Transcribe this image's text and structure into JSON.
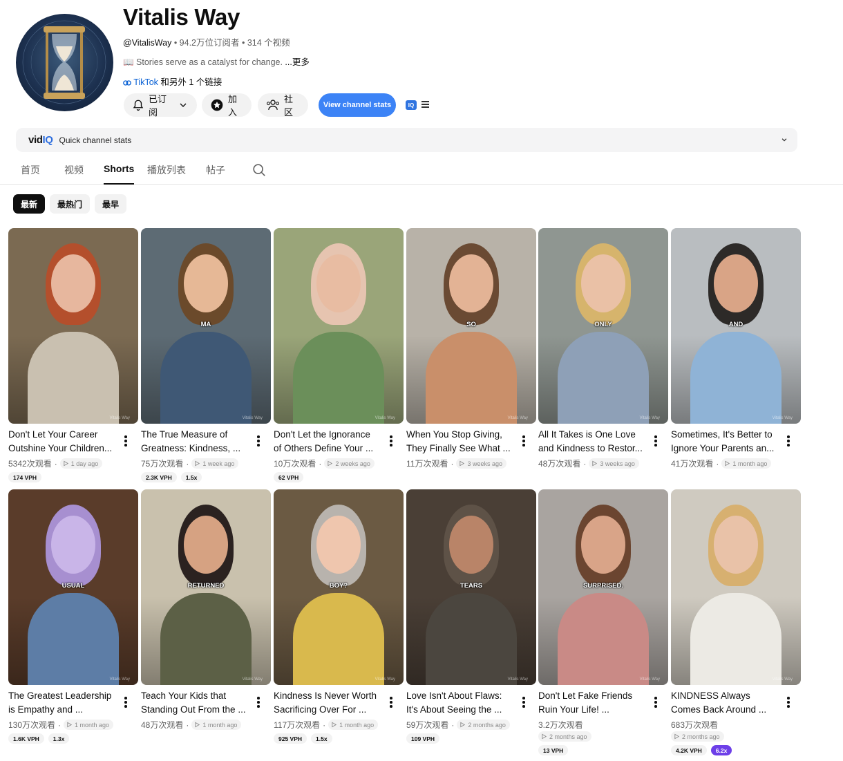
{
  "channel": {
    "name": "Vitalis Way",
    "handle": "@VitalisWay",
    "subs_and_videos": " • 94.2万位订阅者 • 314 个视频",
    "description": "📖 Stories serve as a catalyst for change. ",
    "more": "...更多",
    "link_name": "TikTok",
    "link_rest": " 和另外 1 个链接"
  },
  "buttons": {
    "subscribed": "已订阅",
    "join": "加入",
    "community": "社区",
    "view_stats": "View channel stats",
    "iq": "IQ"
  },
  "vidiq": {
    "logo_a": "vid",
    "logo_b": "IQ",
    "label": "Quick channel stats"
  },
  "tabs": [
    "首页",
    "视频",
    "Shorts",
    "播放列表",
    "帖子"
  ],
  "chips": [
    "最新",
    "最热门",
    "最早"
  ],
  "videos": [
    {
      "title1": "Don't Let Your Career",
      "title2": "Outshine Your Children...",
      "views": "5342次观看",
      "age": "1 day ago",
      "tags": [
        "174 VPH"
      ],
      "word": "",
      "bg": "#7b6a52",
      "skin": "#e7b79e",
      "hair": "#b44f2c",
      "shirt": "#c9c0b0"
    },
    {
      "title1": "The True Measure of",
      "title2": "Greatness: Kindness, ...",
      "views": "75万次观看",
      "age": "1 week ago",
      "tags": [
        "2.3K VPH",
        "1.5x"
      ],
      "word": "MA",
      "bg": "#5d6b74",
      "skin": "#e6b896",
      "hair": "#6b4a2b",
      "shirt": "#3f5875"
    },
    {
      "title1": "Don't Let the Ignorance",
      "title2": "of Others Define Your ...",
      "views": "10万次观看",
      "age": "2 weeks ago",
      "tags": [
        "62 VPH"
      ],
      "word": "",
      "bg": "#9aa579",
      "skin": "#e8bca2",
      "hair": "#e6c4b0",
      "shirt": "#6b8f5a"
    },
    {
      "title1": "When You Stop Giving,",
      "title2": "They Finally See What ...",
      "views": "11万次观看",
      "age": "3 weeks ago",
      "tags": [],
      "word": "SO",
      "bg": "#b8b2a8",
      "skin": "#e3b395",
      "hair": "#6a4a33",
      "shirt": "#c98f6a"
    },
    {
      "title1": "All It Takes is One Love",
      "title2": "and Kindness to Restor...",
      "views": "48万次观看",
      "age": "3 weeks ago",
      "tags": [],
      "word": "ONLY",
      "bg": "#8f9691",
      "skin": "#eac1a6",
      "hair": "#d6b46c",
      "shirt": "#8ea0b7"
    },
    {
      "title1": "Sometimes, It's Better to",
      "title2": "Ignore Your Parents an...",
      "views": "41万次观看",
      "age": "1 month ago",
      "tags": [],
      "word": "AND",
      "bg": "#b9bdc0",
      "skin": "#d9a486",
      "hair": "#2d2a28",
      "shirt": "#8fb3d6"
    },
    {
      "title1": "The Greatest Leadership",
      "title2": "is Empathy and ...",
      "views": "130万次观看",
      "age": "1 month ago",
      "tags": [
        "1.6K VPH",
        "1.3x"
      ],
      "word": "USUAL",
      "bg": "#5a3c2a",
      "skin": "#c9b5e8",
      "hair": "#a78fd0",
      "shirt": "#5d7da6"
    },
    {
      "title1": "Teach Your Kids that",
      "title2": "Standing Out From the ...",
      "views": "48万次观看",
      "age": "1 month ago",
      "tags": [],
      "word": "RETURNED",
      "bg": "#c9c1ad",
      "skin": "#d6a282",
      "hair": "#2b2220",
      "shirt": "#5c6046"
    },
    {
      "title1": "Kindness Is Never Worth",
      "title2": "Sacrificing Over For ...",
      "views": "117万次观看",
      "age": "1 month ago",
      "tags": [
        "925 VPH",
        "1.5x"
      ],
      "word": "BOY?",
      "bg": "#6b5a43",
      "skin": "#efc6ae",
      "hair": "#b8b3ad",
      "shirt": "#d9b94d"
    },
    {
      "title1": "Love Isn't About Flaws:",
      "title2": "It's About Seeing the ...",
      "views": "59万次观看",
      "age": "2 months ago",
      "tags": [
        "109 VPH"
      ],
      "word": "TEARS",
      "bg": "#4a3f36",
      "skin": "#b98468",
      "hair": "#5e5247",
      "shirt": "#4b463f"
    },
    {
      "title1": "Don't Let Fake Friends",
      "title2": "Ruin Your Life! ...",
      "views": "3.2万次观看",
      "age": "2 months ago",
      "tags": [
        "13 VPH"
      ],
      "word": "SURPRISED.",
      "bg": "#a9a4a0",
      "skin": "#d9a488",
      "hair": "#6b4530",
      "shirt": "#c98a86"
    },
    {
      "title1": "KINDNESS Always",
      "title2": "Comes Back Around ...",
      "views": "683万次观看",
      "age": "2 months ago",
      "tags": [
        "4.2K VPH",
        "6.2x"
      ],
      "word": "",
      "bg": "#cfcac0",
      "skin": "#e9c2a8",
      "hair": "#d7b070",
      "shirt": "#eceae4"
    }
  ],
  "watermark": "Vitalis Way"
}
